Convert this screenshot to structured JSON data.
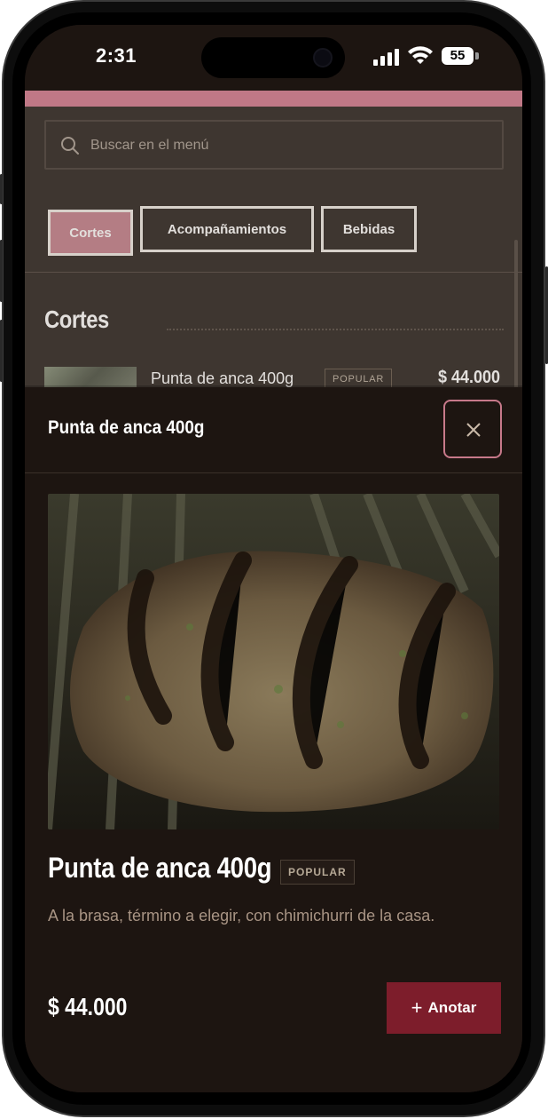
{
  "status_bar": {
    "time": "2:31",
    "battery": "55"
  },
  "search": {
    "placeholder": "Buscar en el menú"
  },
  "tabs": [
    {
      "label": "Cortes",
      "active": true
    },
    {
      "label": "Acompañamientos",
      "active": false
    },
    {
      "label": "Bebidas",
      "active": false
    }
  ],
  "section": {
    "title": "Cortes"
  },
  "background_item": {
    "name": "Punta de anca 400g",
    "badge": "POPULAR",
    "price": "$ 44.000"
  },
  "modal": {
    "header_title": "Punta de anca 400g",
    "item": {
      "title": "Punta de anca 400g",
      "badge": "POPULAR",
      "description": "A la brasa, término a elegir, con chimichurri de la casa.",
      "price": "$ 44.000",
      "add_label": "Anotar"
    }
  },
  "colors": {
    "accent_pink": "#c07886",
    "button_red": "#7d1d2b",
    "background": "#1d1511"
  },
  "icons": [
    "search-icon",
    "close-icon",
    "plus-icon",
    "signal-icon",
    "wifi-icon",
    "battery-icon"
  ]
}
